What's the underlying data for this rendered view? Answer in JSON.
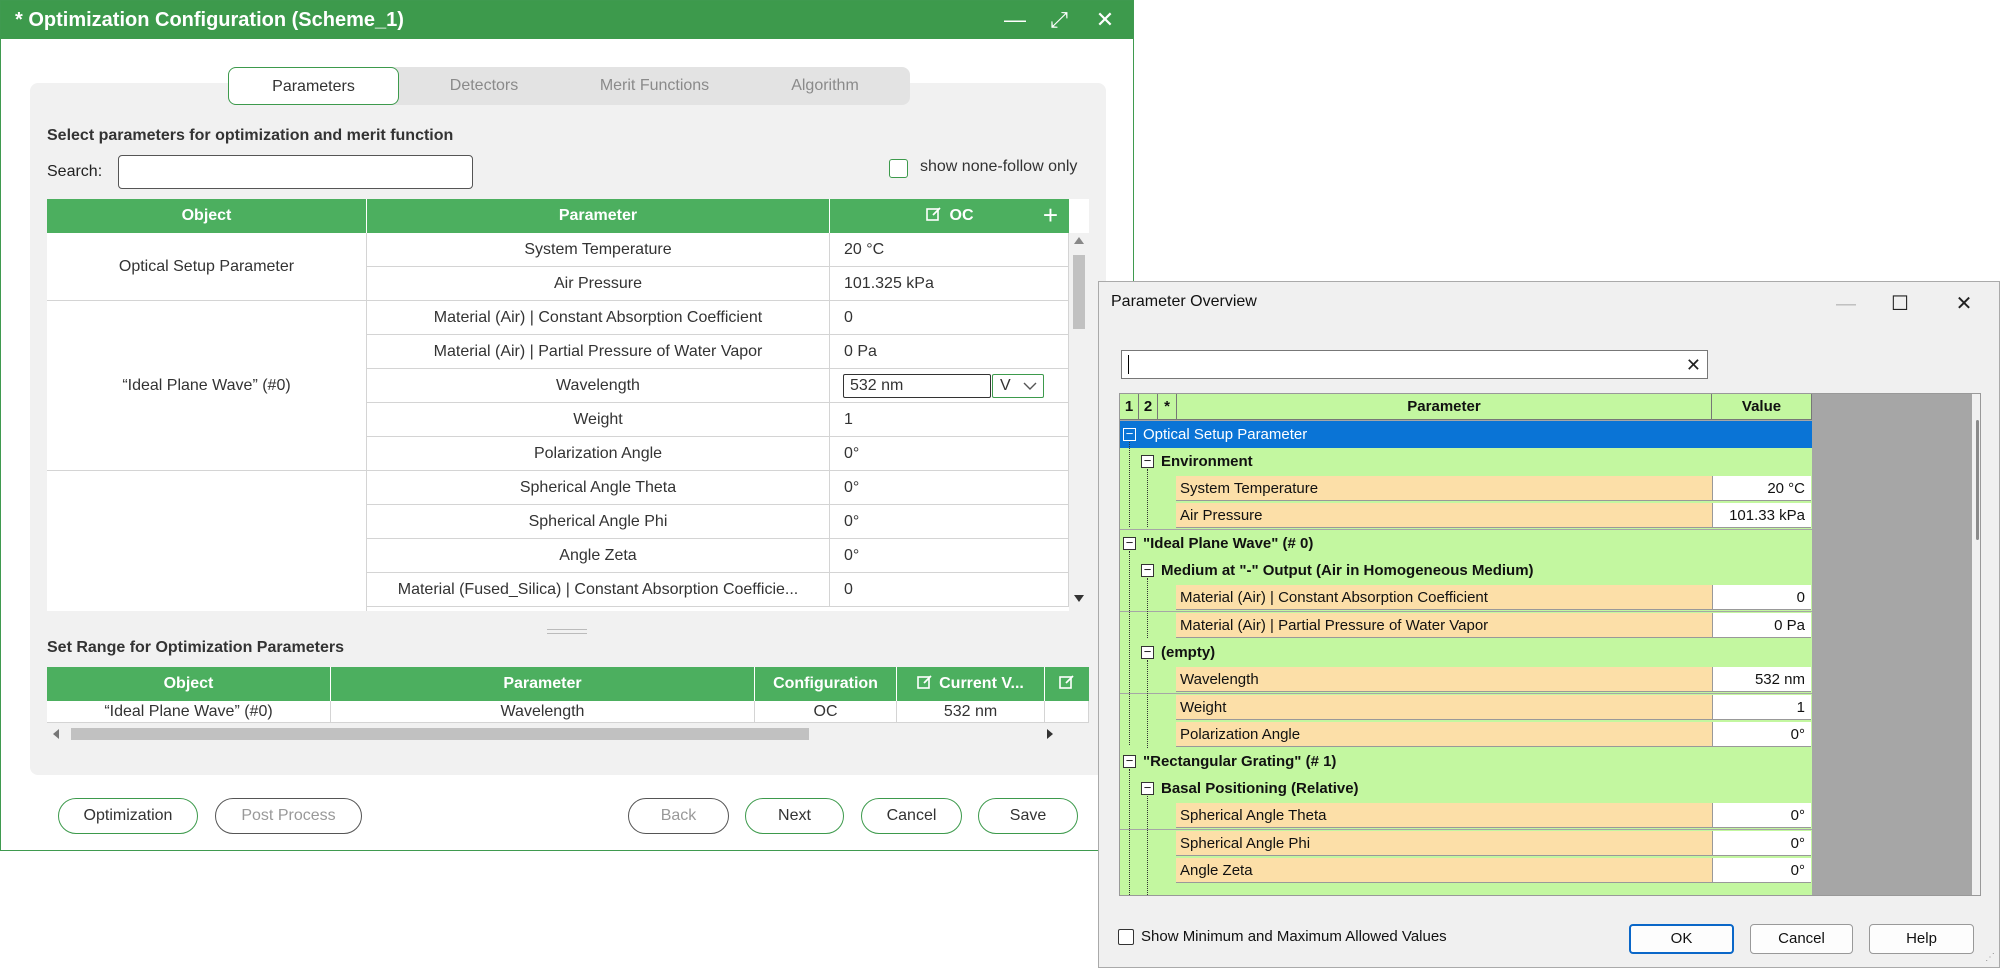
{
  "main_window": {
    "title": "* Optimization Configuration (Scheme_1)",
    "controls": {
      "minimize": "—",
      "maximize": "⤢",
      "close": "✕"
    },
    "tabs": [
      {
        "label": "Parameters",
        "active": true
      },
      {
        "label": "Detectors",
        "active": false
      },
      {
        "label": "Merit Functions",
        "active": false
      },
      {
        "label": "Algorithm",
        "active": false
      }
    ],
    "section_title": "Select parameters for optimization and merit function",
    "search_label": "Search:",
    "search_value": "",
    "show_none_follow_label": "show none-follow only",
    "param_table": {
      "columns": {
        "object": "Object",
        "parameter": "Parameter",
        "oc": "OC",
        "add": "+"
      },
      "groups": [
        {
          "object": "Optical Setup Parameter",
          "rows": [
            {
              "parameter": "System Temperature",
              "value": "20 °C"
            },
            {
              "parameter": "Air Pressure",
              "value": "101.325 kPa"
            }
          ]
        },
        {
          "object": "“Ideal Plane Wave” (#0)",
          "rows": [
            {
              "parameter": "Material (Air) | Constant Absorption Coefficient",
              "value": "0"
            },
            {
              "parameter": "Material (Air) | Partial Pressure of Water Vapor",
              "value": "0 Pa"
            },
            {
              "parameter": "Wavelength",
              "value": "532 nm",
              "editing": true,
              "mode": "V"
            },
            {
              "parameter": "Weight",
              "value": "1"
            },
            {
              "parameter": "Polarization Angle",
              "value": "0°"
            }
          ]
        },
        {
          "object": "",
          "rows": [
            {
              "parameter": "Spherical Angle Theta",
              "value": "0°"
            },
            {
              "parameter": "Spherical Angle Phi",
              "value": "0°"
            },
            {
              "parameter": "Angle Zeta",
              "value": "0°"
            },
            {
              "parameter": "Material (Fused_Silica) | Constant Absorption Coefficie...",
              "value": "0"
            }
          ]
        }
      ]
    },
    "range_title": "Set Range for Optimization Parameters",
    "range_table": {
      "columns": [
        "Object",
        "Parameter",
        "Configuration",
        "Current V..."
      ],
      "rows": [
        {
          "object": "“Ideal Plane Wave” (#0)",
          "parameter": "Wavelength",
          "configuration": "OC",
          "current": "532 nm"
        }
      ]
    },
    "buttons": {
      "optimization": "Optimization",
      "post_process": "Post Process",
      "back": "Back",
      "next": "Next",
      "cancel": "Cancel",
      "save": "Save"
    }
  },
  "overview_dialog": {
    "title": "Parameter Overview",
    "controls": {
      "minimize": "—",
      "maximize": "☐",
      "close": "✕"
    },
    "search_value": "",
    "clear_icon": "✕",
    "columns": {
      "c1": "1",
      "c2": "2",
      "c3": "*",
      "parameter": "Parameter",
      "value": "Value"
    },
    "tree": [
      {
        "level": 0,
        "label": "Optical Setup Parameter",
        "selected": true
      },
      {
        "level": 1,
        "label": "Environment"
      },
      {
        "level": 2,
        "label": "System Temperature",
        "value": "20 °C"
      },
      {
        "level": 2,
        "label": "Air Pressure",
        "value": "101.33 kPa"
      },
      {
        "level": 0,
        "label": "\"Ideal Plane Wave\" (# 0)"
      },
      {
        "level": 1,
        "label": "Medium at \"-\" Output (Air in Homogeneous Medium)"
      },
      {
        "level": 2,
        "label": "Material (Air) | Constant Absorption Coefficient",
        "value": "0"
      },
      {
        "level": 2,
        "label": "Material (Air) | Partial Pressure of Water Vapor",
        "value": "0 Pa"
      },
      {
        "level": 1,
        "label": "(empty)"
      },
      {
        "level": 2,
        "label": "Wavelength",
        "value": "532 nm"
      },
      {
        "level": 2,
        "label": "Weight",
        "value": "1"
      },
      {
        "level": 2,
        "label": "Polarization Angle",
        "value": "0°"
      },
      {
        "level": 0,
        "label": "\"Rectangular Grating\" (# 1)"
      },
      {
        "level": 1,
        "label": "Basal Positioning (Relative)"
      },
      {
        "level": 2,
        "label": "Spherical Angle Theta",
        "value": "0°"
      },
      {
        "level": 2,
        "label": "Spherical Angle Phi",
        "value": "0°"
      },
      {
        "level": 2,
        "label": "Angle Zeta",
        "value": "0°"
      }
    ],
    "show_minmax_label": "Show Minimum and Maximum Allowed Values",
    "buttons": {
      "ok": "OK",
      "cancel": "Cancel",
      "help": "Help"
    }
  }
}
